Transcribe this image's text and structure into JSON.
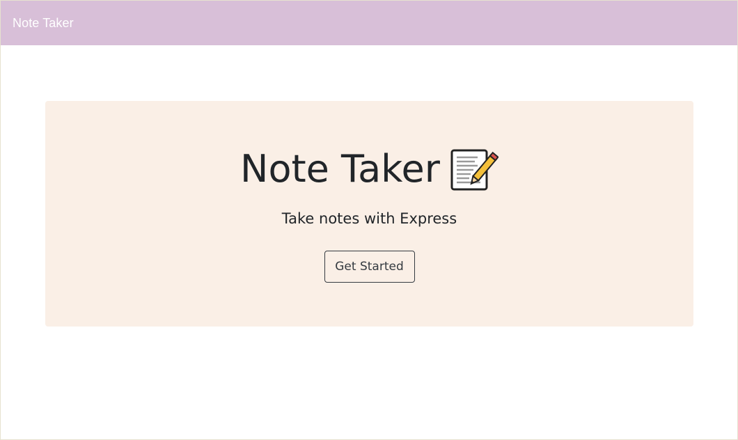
{
  "navbar": {
    "brand": "Note Taker"
  },
  "hero": {
    "title": "Note Taker",
    "title_icon": "memo-icon",
    "subtitle": "Take notes with Express",
    "cta_label": "Get Started"
  },
  "colors": {
    "navbar_bg": "#d8bfd8",
    "hero_bg": "#faefe6",
    "text": "#212529"
  }
}
